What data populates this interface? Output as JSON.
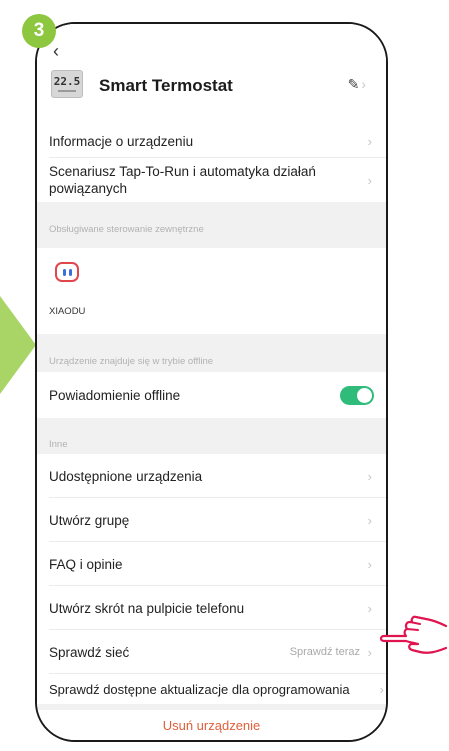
{
  "step_badge": "3",
  "header": {
    "back_icon": "chevron-left-icon",
    "device_icon_digits": "22.5",
    "title": "Smart Termostat",
    "edit_icon": "pencil-icon"
  },
  "rows": {
    "device_info": "Informacje o urządzeniu",
    "tap_to_run": "Scenariusz Tap-To-Run i automatyka działań powiązanych",
    "share": "Udostępnione urządzenia",
    "create_group": "Utwórz grupę",
    "faq": "FAQ i opinie",
    "shortcut": "Utwórz skrót na pulpicie telefonu",
    "check_network": "Sprawdź sieć",
    "check_network_value": "Sprawdź teraz",
    "check_updates": "Sprawdź dostępne aktualizacje dla oprogramowania"
  },
  "sections": {
    "external_control": "Obsługiwane sterowanie zewnętrzne",
    "offline": "Urządzenie znajduje się w trybie offline",
    "other": "Inne"
  },
  "external": {
    "xiaodu_label": "XIAODU"
  },
  "offline_notification": {
    "label": "Powiadomienie offline",
    "enabled": true,
    "toggle_color": "#2fbb7a"
  },
  "remove_device": "Usuń urządzenie",
  "colors": {
    "badge": "#8dc63f",
    "accent_arrow": "#a9d566",
    "remove_text": "#e05f3a"
  }
}
